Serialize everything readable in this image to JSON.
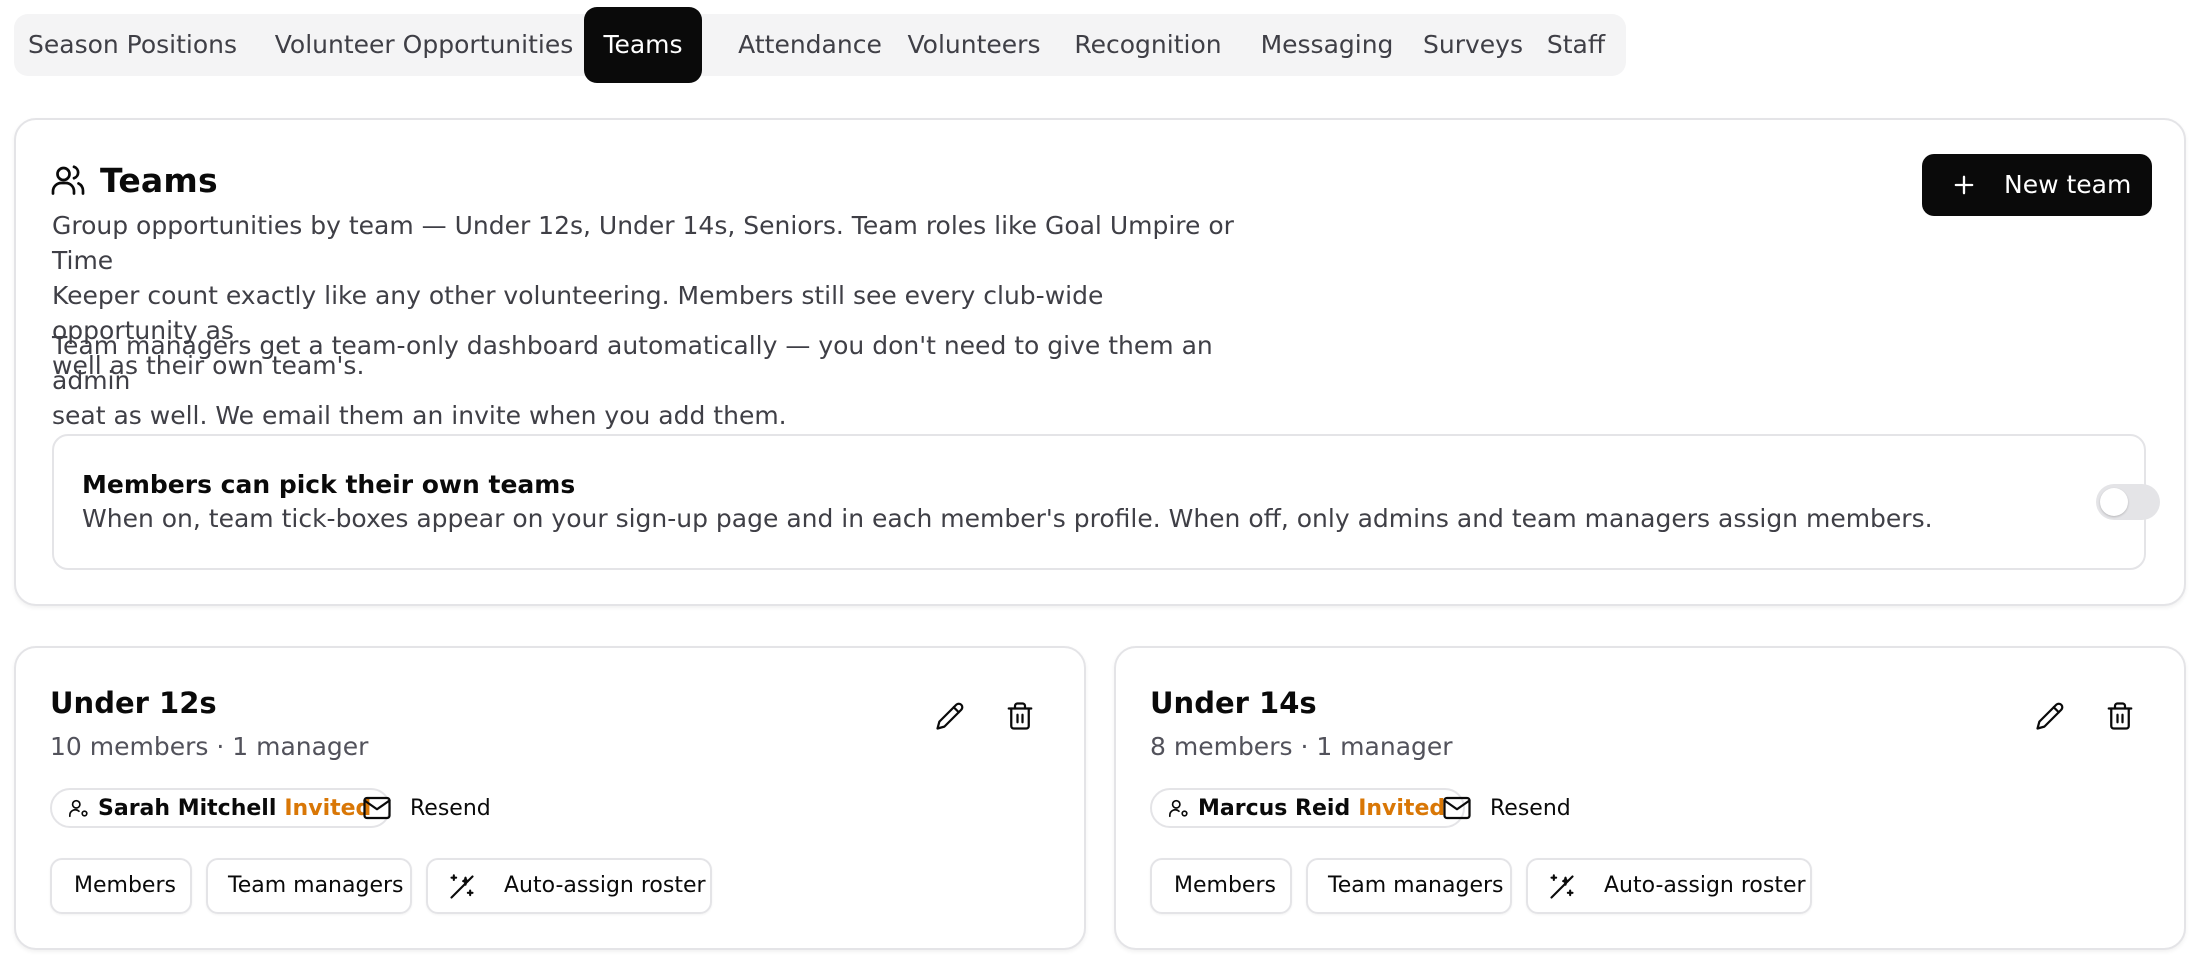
{
  "tabs": [
    {
      "label": "Season Positions",
      "active": false
    },
    {
      "label": "Volunteer Opportunities",
      "active": false
    },
    {
      "label": "Teams",
      "active": true
    },
    {
      "label": "Attendance",
      "active": false
    },
    {
      "label": "Volunteers",
      "active": false
    },
    {
      "label": "Recognition",
      "active": false
    },
    {
      "label": "Messaging",
      "active": false
    },
    {
      "label": "Surveys",
      "active": false
    },
    {
      "label": "Staff",
      "active": false
    }
  ],
  "header": {
    "title": "Teams",
    "title_icon": "users-icon",
    "desc_lines_1": [
      "Group opportunities by team — Under 12s, Under 14s, Seniors. Team roles like Goal Umpire or Time",
      "Keeper count exactly like any other volunteering. Members still see every club-wide opportunity as",
      "well as their own team's."
    ],
    "desc_lines_2": [
      "Team managers get a team-only dashboard automatically — you don't need to give them an admin",
      "seat as well. We email them an invite when you add them."
    ],
    "new_team_label": "New team"
  },
  "setting": {
    "title": "Members can pick their own teams",
    "description": "When on, team tick-boxes appear on your sign-up page and in each member's profile. When off, only admins and team managers assign members.",
    "enabled": false
  },
  "teams": [
    {
      "name": "Under 12s",
      "summary": "10 members · 1 manager",
      "manager": {
        "name": "Sarah Mitchell",
        "status": "Invited"
      },
      "resend_label": "Resend",
      "actions": {
        "members": "Members",
        "managers": "Team managers",
        "auto_assign": "Auto-assign roster"
      }
    },
    {
      "name": "Under 14s",
      "summary": "8 members · 1 manager",
      "manager": {
        "name": "Marcus Reid",
        "status": "Invited"
      },
      "resend_label": "Resend",
      "actions": {
        "members": "Members",
        "managers": "Team managers",
        "auto_assign": "Auto-assign roster"
      }
    }
  ],
  "colors": {
    "accent": "#0a0a0a",
    "invited": "#d97706",
    "muted": "#3f3f46",
    "border": "#e4e4e7"
  }
}
